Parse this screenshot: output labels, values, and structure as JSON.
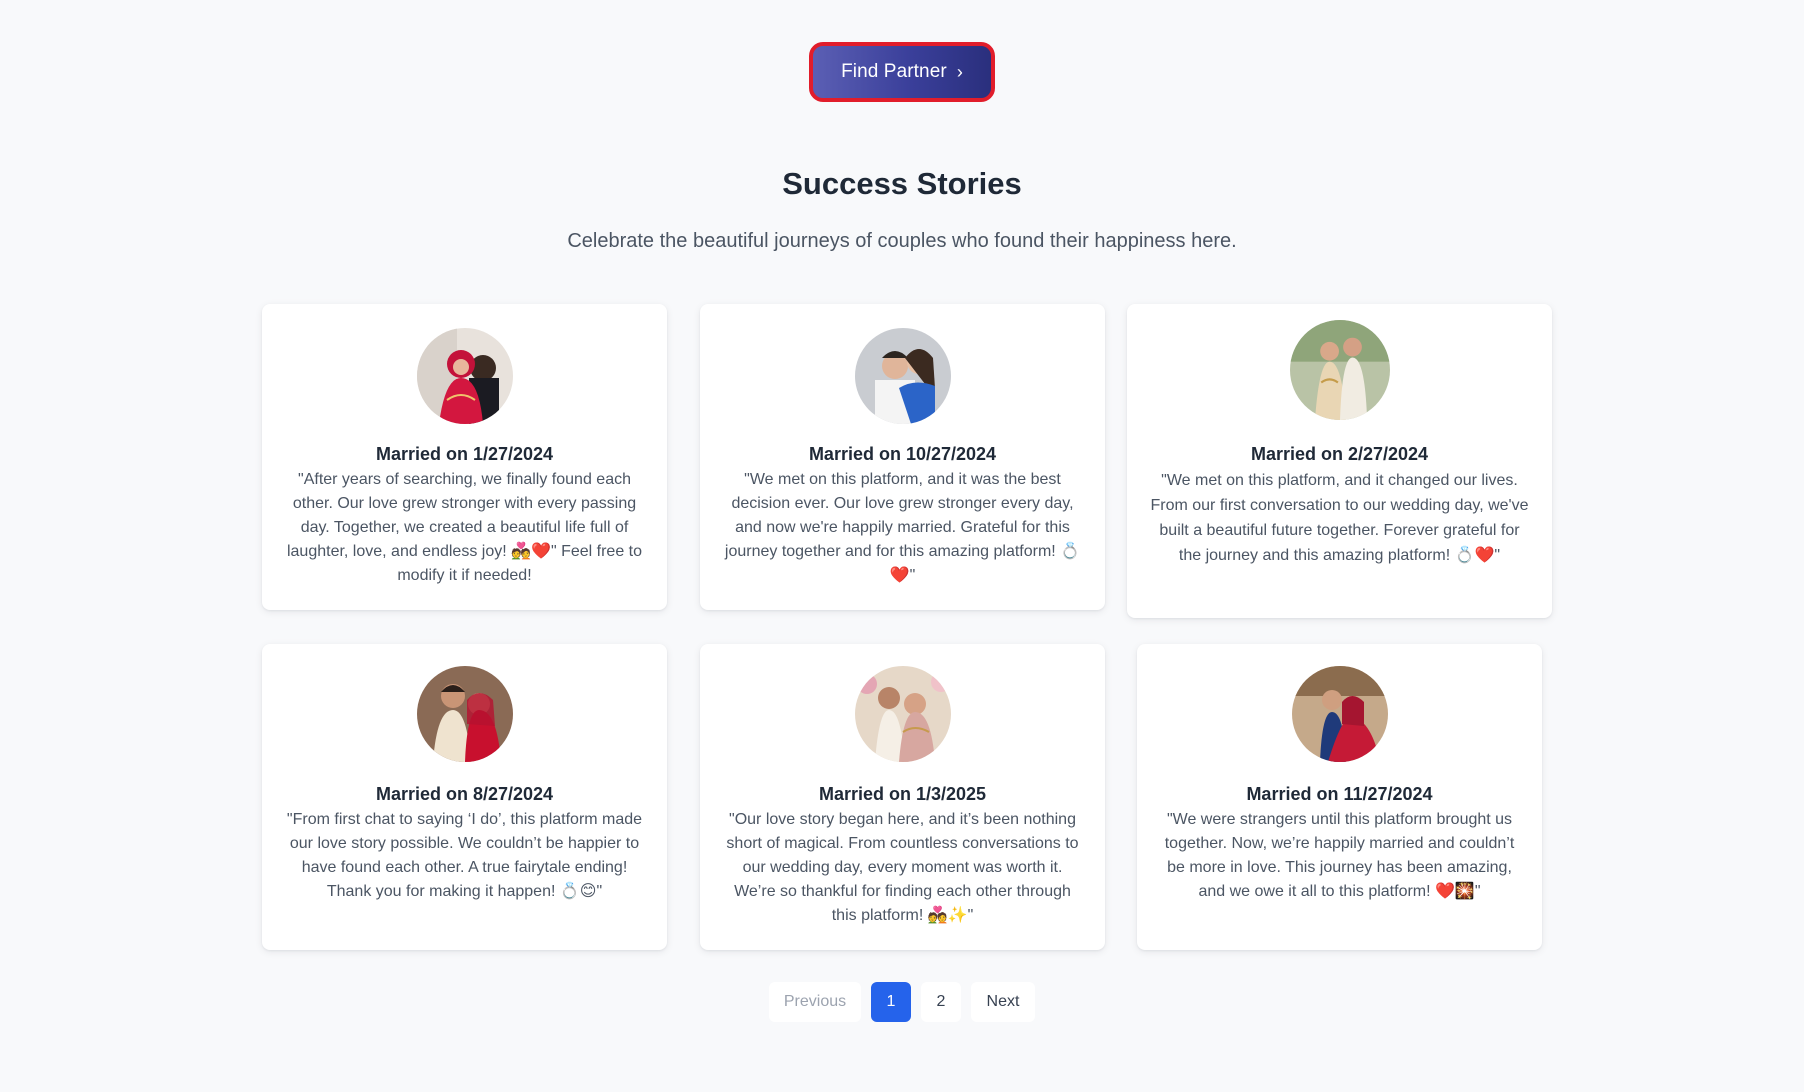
{
  "cta": {
    "label": "Find Partner",
    "chevron": "›"
  },
  "section": {
    "title": "Success Stories",
    "subtitle": "Celebrate the beautiful journeys of couples who found their happiness here."
  },
  "stories": [
    {
      "married": "Married on 1/27/2024",
      "quote": "\"After years of searching, we finally found each other. Our love grew stronger with every passing day. Together, we created a beautiful life full of laughter, love, and endless joy! 💑❤️\" Feel free to modify it if needed!",
      "avatar": "couple-photo-red-dress-icon"
    },
    {
      "married": "Married on 10/27/2024",
      "quote": "\"We met on this platform, and it was the best decision ever. Our love grew stronger every day, and now we're happily married. Grateful for this journey together and for this amazing platform! 💍❤️\"",
      "avatar": "couple-photo-hug-icon"
    },
    {
      "married": "Married on 2/27/2024",
      "quote": "\"We met on this platform, and it changed our lives. From our first conversation to our wedding day, we've built a beautiful future together. Forever grateful for the journey and this amazing platform! 💍❤️\"",
      "avatar": "couple-photo-garden-icon"
    },
    {
      "married": "Married on 8/27/2024",
      "quote": "\"From first chat to saying ‘I do’, this platform made our love story possible. We couldn’t be happier to have found each other. A true fairytale ending! Thank you for making it happen! 💍😊\"",
      "avatar": "couple-photo-bridal-icon"
    },
    {
      "married": "Married on 1/3/2025",
      "quote": "\"Our love story began here, and it’s been nothing short of magical. From countless conversations to our wedding day, every moment was worth it. We’re so thankful for finding each other through this platform! 💑✨\"",
      "avatar": "couple-photo-flowers-icon"
    },
    {
      "married": "Married on 11/27/2024",
      "quote": "\"We were strangers until this platform brought us together. Now, we’re happily married and couldn’t be more in love. This journey has been amazing, and we owe it all to this platform! ❤️🎇\"",
      "avatar": "couple-photo-hall-icon"
    }
  ],
  "pagination": {
    "previous": "Previous",
    "pages": [
      "1",
      "2"
    ],
    "current": "1",
    "next": "Next"
  },
  "colors": {
    "background": "#f8f9fb",
    "cta_gradient_start": "#5b5fb4",
    "cta_gradient_end": "#2a2f7d",
    "cta_border": "#e11d2b",
    "active_page": "#2563eb"
  }
}
